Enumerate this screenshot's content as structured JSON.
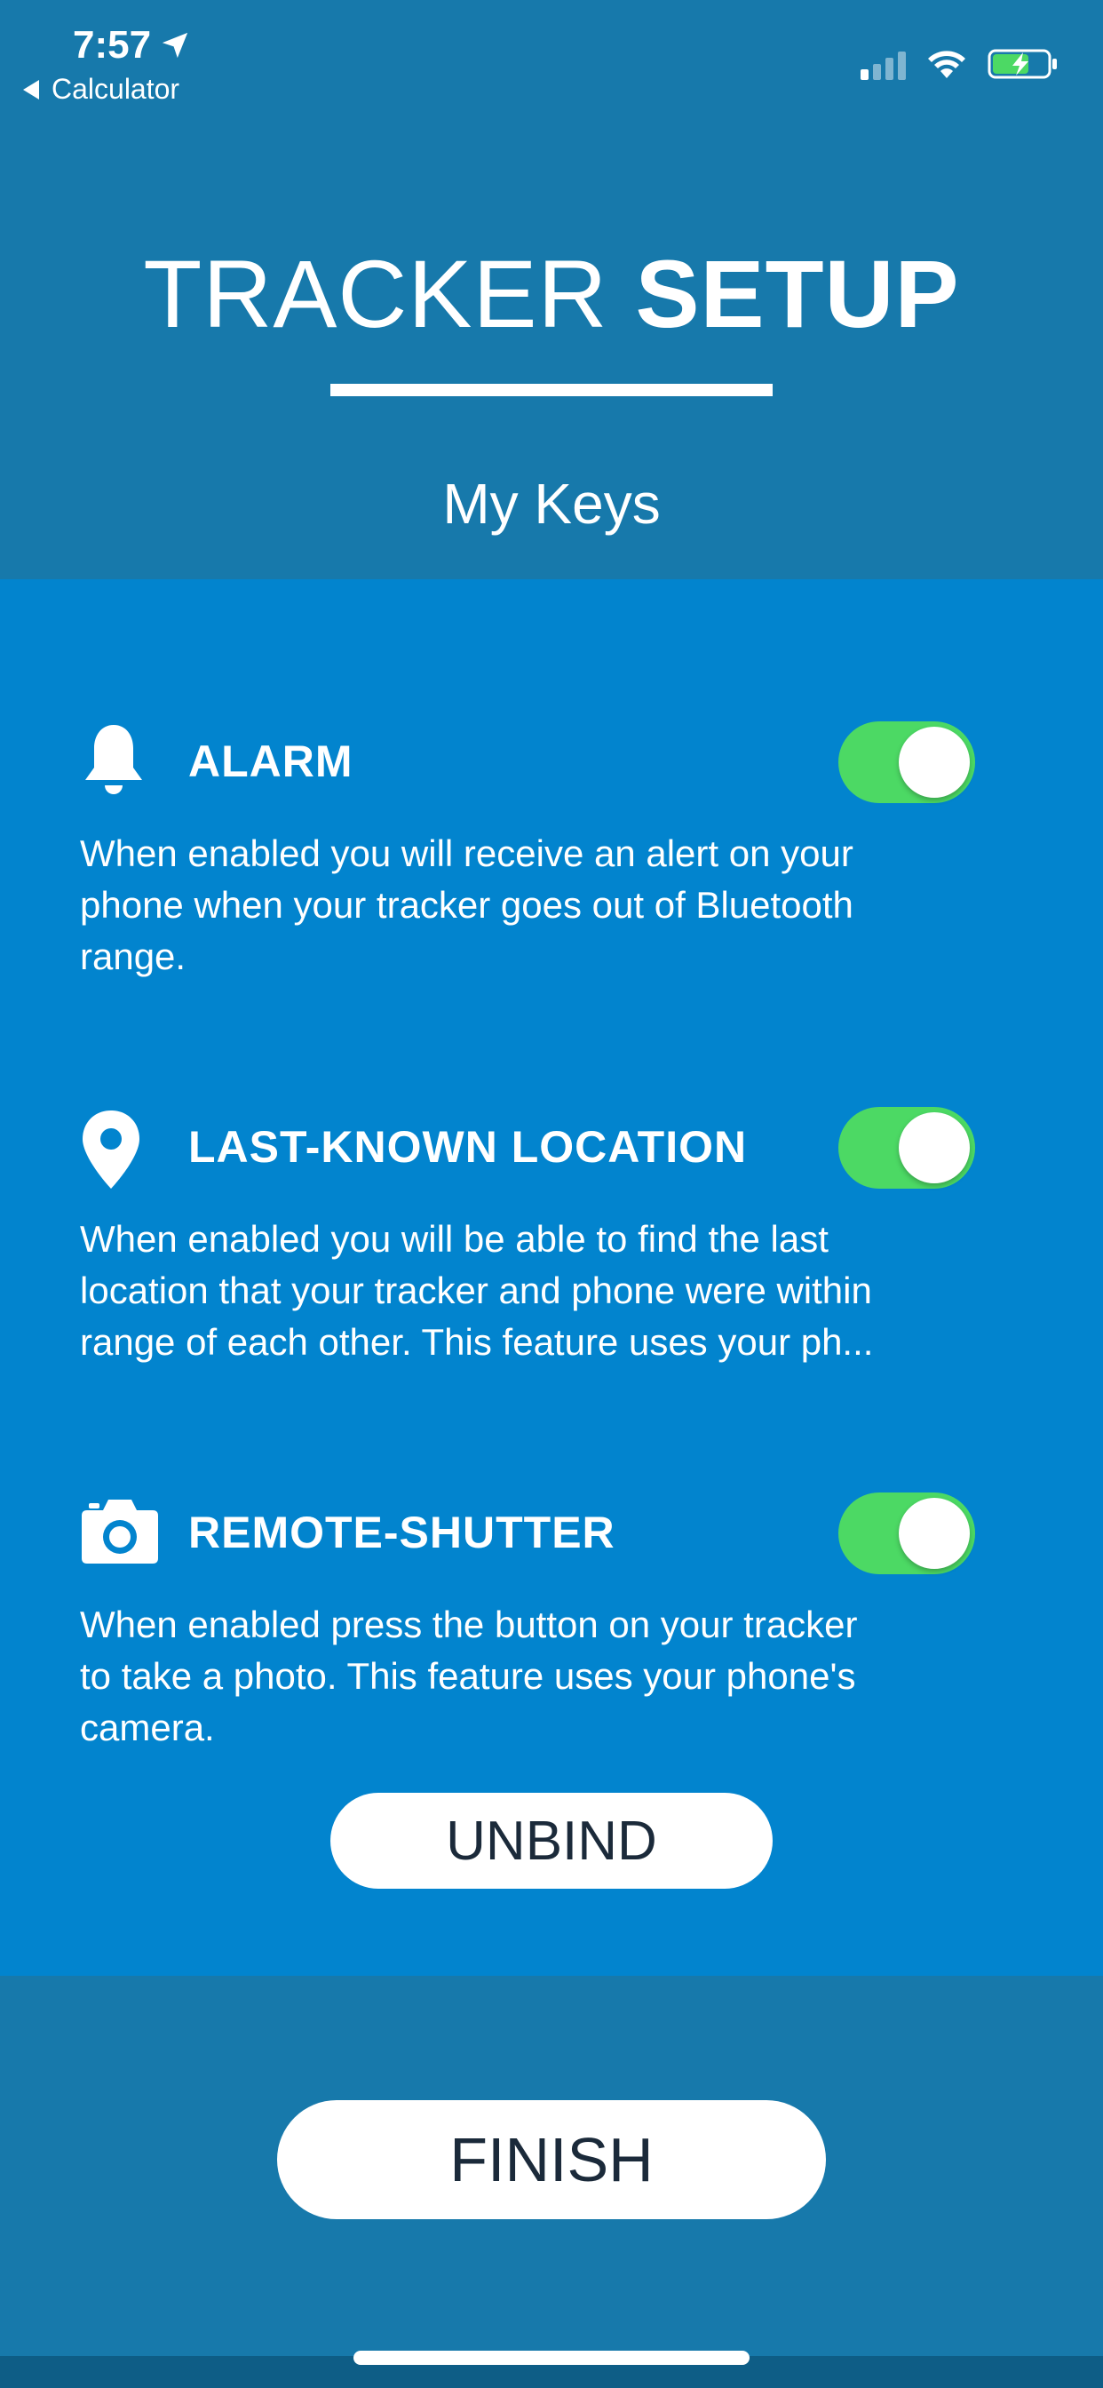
{
  "status_bar": {
    "time": "7:57",
    "back_app": "Calculator",
    "icons": [
      "location-arrow-icon",
      "signal-icon",
      "wifi-icon",
      "battery-charging-icon"
    ]
  },
  "header": {
    "title_light": "TRACKER ",
    "title_bold": "SETUP",
    "device_name": "My Keys"
  },
  "features": [
    {
      "title": "ALARM",
      "icon": "bell-icon",
      "enabled": true,
      "description_lines": [
        "When enabled you will receive an alert on your",
        "phone when your tracker goes out of Bluetooth",
        "range."
      ]
    },
    {
      "title": "LAST-KNOWN LOCATION",
      "icon": "location-pin-icon",
      "enabled": true,
      "description_lines": [
        "When enabled you will be able to find the last",
        "location that your tracker and phone were within",
        "range of each other.  This feature uses your ph..."
      ]
    },
    {
      "title": "REMOTE-SHUTTER",
      "icon": "camera-icon",
      "enabled": true,
      "description_lines": [
        "When enabled press the button on your tracker",
        "to take a photo.  This feature uses your phone's",
        "camera."
      ]
    }
  ],
  "buttons": {
    "unbind": "UNBIND",
    "finish": "FINISH"
  },
  "colors": {
    "header_bg": "#1779AB",
    "panel_bg": "#0284CE",
    "toggle_on": "#4CD964",
    "button_text": "#1B2A3A"
  }
}
